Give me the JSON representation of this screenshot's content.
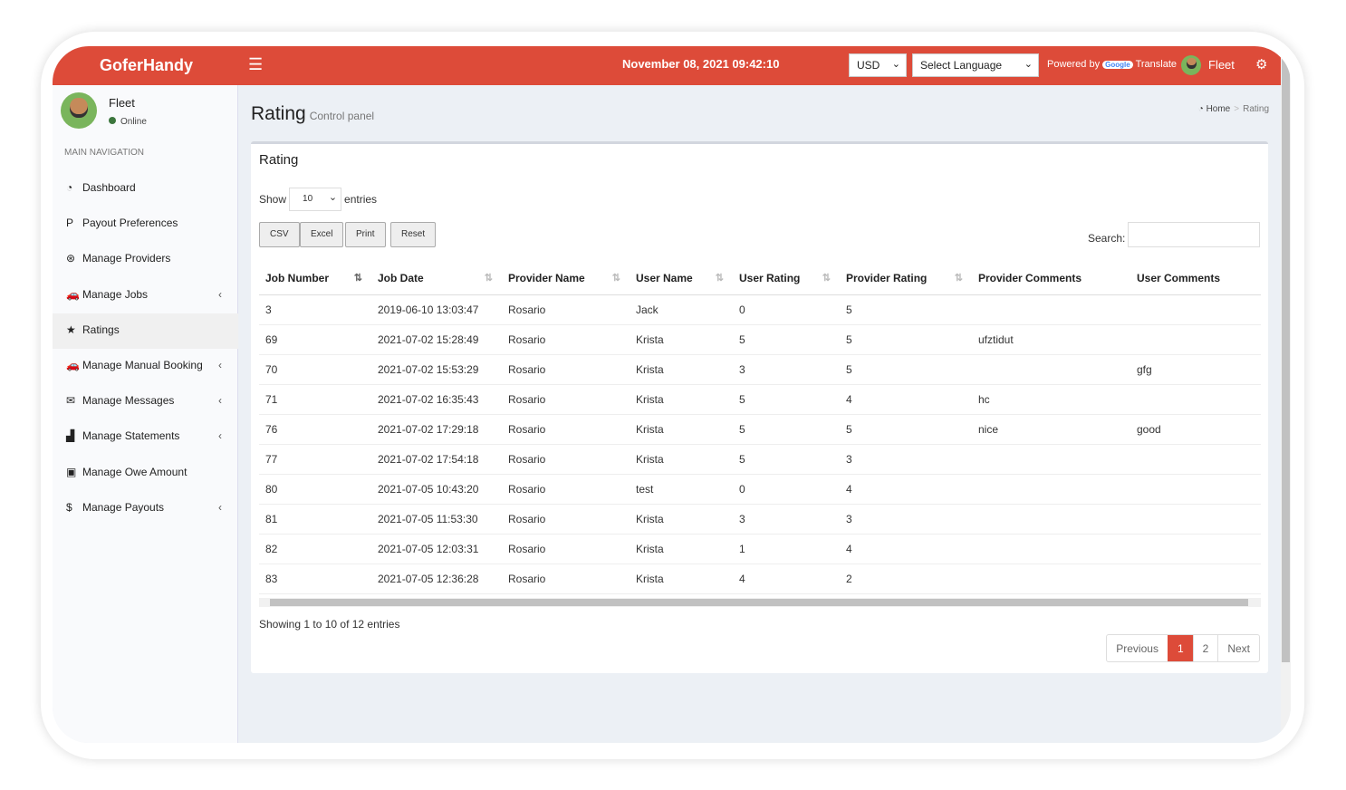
{
  "header": {
    "logo": "GoferHandy",
    "datetime": "November 08, 2021 09:42:10",
    "currency": "USD",
    "language": "Select Language",
    "powered_by": "Powered by",
    "google": "Google",
    "translate": "Translate",
    "user": "Fleet",
    "accent": "#dd4b39"
  },
  "sidebar": {
    "user": "Fleet",
    "status": "Online",
    "section": "MAIN NAVIGATION",
    "items": [
      {
        "label": "Dashboard",
        "icon": "dashboard-icon",
        "glyph": "◔",
        "chev": ""
      },
      {
        "label": "Payout Preferences",
        "icon": "paypal-icon",
        "glyph": "P",
        "chev": ""
      },
      {
        "label": "Manage Providers",
        "icon": "providers-icon",
        "glyph": "⊛",
        "chev": ""
      },
      {
        "label": "Manage Jobs",
        "icon": "car-icon",
        "glyph": "🚗",
        "chev": "‹"
      },
      {
        "label": "Ratings",
        "icon": "star-icon",
        "glyph": "★",
        "chev": ""
      },
      {
        "label": "Manage Manual Booking",
        "icon": "car-icon",
        "glyph": "🚗",
        "chev": "‹"
      },
      {
        "label": "Manage Messages",
        "icon": "envelope-icon",
        "glyph": "✉",
        "chev": "‹"
      },
      {
        "label": "Manage Statements",
        "icon": "chart-icon",
        "glyph": "▟",
        "chev": "‹"
      },
      {
        "label": "Manage Owe Amount",
        "icon": "money-icon",
        "glyph": "▣",
        "chev": ""
      },
      {
        "label": "Manage Payouts",
        "icon": "dollar-icon",
        "glyph": "$",
        "chev": "‹"
      }
    ]
  },
  "page": {
    "title": "Rating",
    "subtitle": "Control panel",
    "breadcrumb": {
      "home": "Home",
      "sep": ">",
      "current": "Rating"
    }
  },
  "box": {
    "title": "Rating",
    "show": "Show",
    "length": "10",
    "entries": "entries",
    "buttons": [
      "CSV",
      "Excel",
      "Print",
      "Reset"
    ],
    "search_label": "Search:",
    "search_value": "",
    "columns": [
      "Job Number",
      "Job Date",
      "Provider Name",
      "User Name",
      "User Rating",
      "Provider Rating",
      "Provider Comments",
      "User Comments"
    ],
    "rows": [
      [
        "3",
        "2019-06-10 13:03:47",
        "Rosario",
        "Jack",
        "0",
        "5",
        "",
        ""
      ],
      [
        "69",
        "2021-07-02 15:28:49",
        "Rosario",
        "Krista",
        "5",
        "5",
        "ufztidut",
        ""
      ],
      [
        "70",
        "2021-07-02 15:53:29",
        "Rosario",
        "Krista",
        "3",
        "5",
        "",
        "gfg"
      ],
      [
        "71",
        "2021-07-02 16:35:43",
        "Rosario",
        "Krista",
        "5",
        "4",
        "hc",
        ""
      ],
      [
        "76",
        "2021-07-02 17:29:18",
        "Rosario",
        "Krista",
        "5",
        "5",
        "nice",
        "good"
      ],
      [
        "77",
        "2021-07-02 17:54:18",
        "Rosario",
        "Krista",
        "5",
        "3",
        "",
        ""
      ],
      [
        "80",
        "2021-07-05 10:43:20",
        "Rosario",
        "test",
        "0",
        "4",
        "",
        ""
      ],
      [
        "81",
        "2021-07-05 11:53:30",
        "Rosario",
        "Krista",
        "3",
        "3",
        "",
        ""
      ],
      [
        "82",
        "2021-07-05 12:03:31",
        "Rosario",
        "Krista",
        "1",
        "4",
        "",
        ""
      ],
      [
        "83",
        "2021-07-05 12:36:28",
        "Rosario",
        "Krista",
        "4",
        "2",
        "",
        ""
      ]
    ],
    "info": "Showing 1 to 10 of 12 entries",
    "pager": [
      "Previous",
      "1",
      "2",
      "Next"
    ]
  }
}
